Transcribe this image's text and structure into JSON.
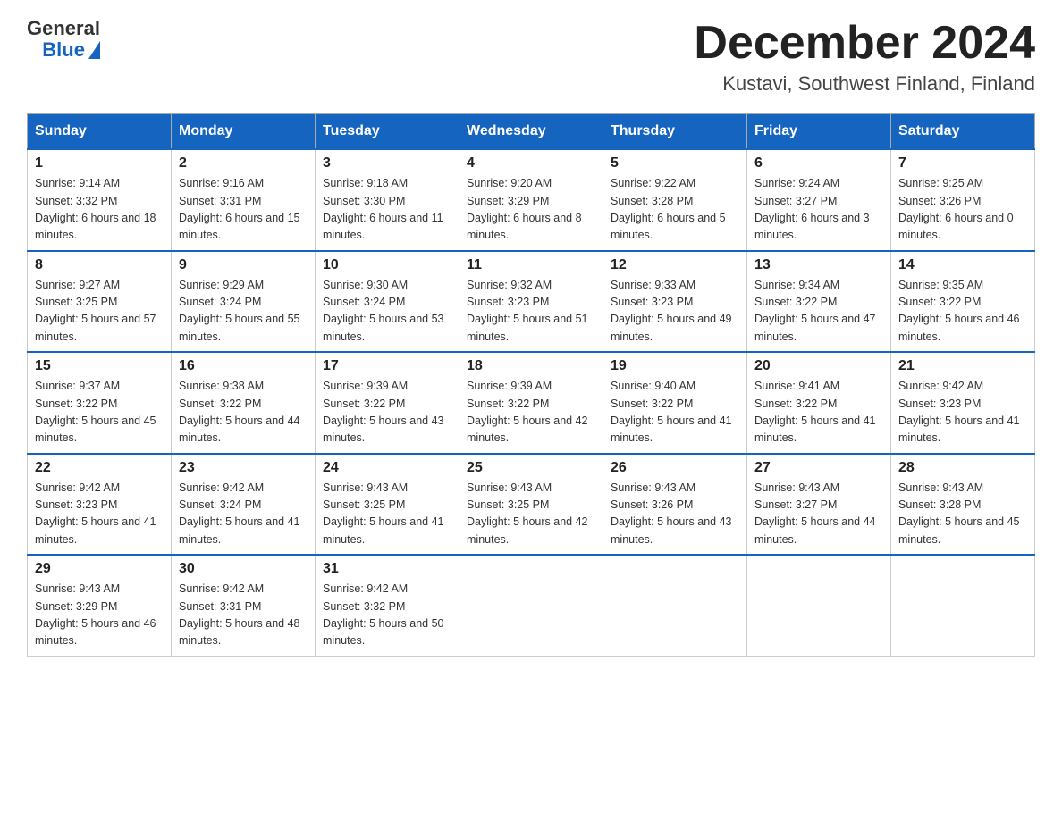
{
  "header": {
    "logo": {
      "text_general": "General",
      "text_blue": "Blue"
    },
    "title": "December 2024",
    "subtitle": "Kustavi, Southwest Finland, Finland"
  },
  "weekdays": [
    "Sunday",
    "Monday",
    "Tuesday",
    "Wednesday",
    "Thursday",
    "Friday",
    "Saturday"
  ],
  "weeks": [
    [
      {
        "day": 1,
        "sunrise": "9:14 AM",
        "sunset": "3:32 PM",
        "daylight": "6 hours and 18 minutes."
      },
      {
        "day": 2,
        "sunrise": "9:16 AM",
        "sunset": "3:31 PM",
        "daylight": "6 hours and 15 minutes."
      },
      {
        "day": 3,
        "sunrise": "9:18 AM",
        "sunset": "3:30 PM",
        "daylight": "6 hours and 11 minutes."
      },
      {
        "day": 4,
        "sunrise": "9:20 AM",
        "sunset": "3:29 PM",
        "daylight": "6 hours and 8 minutes."
      },
      {
        "day": 5,
        "sunrise": "9:22 AM",
        "sunset": "3:28 PM",
        "daylight": "6 hours and 5 minutes."
      },
      {
        "day": 6,
        "sunrise": "9:24 AM",
        "sunset": "3:27 PM",
        "daylight": "6 hours and 3 minutes."
      },
      {
        "day": 7,
        "sunrise": "9:25 AM",
        "sunset": "3:26 PM",
        "daylight": "6 hours and 0 minutes."
      }
    ],
    [
      {
        "day": 8,
        "sunrise": "9:27 AM",
        "sunset": "3:25 PM",
        "daylight": "5 hours and 57 minutes."
      },
      {
        "day": 9,
        "sunrise": "9:29 AM",
        "sunset": "3:24 PM",
        "daylight": "5 hours and 55 minutes."
      },
      {
        "day": 10,
        "sunrise": "9:30 AM",
        "sunset": "3:24 PM",
        "daylight": "5 hours and 53 minutes."
      },
      {
        "day": 11,
        "sunrise": "9:32 AM",
        "sunset": "3:23 PM",
        "daylight": "5 hours and 51 minutes."
      },
      {
        "day": 12,
        "sunrise": "9:33 AM",
        "sunset": "3:23 PM",
        "daylight": "5 hours and 49 minutes."
      },
      {
        "day": 13,
        "sunrise": "9:34 AM",
        "sunset": "3:22 PM",
        "daylight": "5 hours and 47 minutes."
      },
      {
        "day": 14,
        "sunrise": "9:35 AM",
        "sunset": "3:22 PM",
        "daylight": "5 hours and 46 minutes."
      }
    ],
    [
      {
        "day": 15,
        "sunrise": "9:37 AM",
        "sunset": "3:22 PM",
        "daylight": "5 hours and 45 minutes."
      },
      {
        "day": 16,
        "sunrise": "9:38 AM",
        "sunset": "3:22 PM",
        "daylight": "5 hours and 44 minutes."
      },
      {
        "day": 17,
        "sunrise": "9:39 AM",
        "sunset": "3:22 PM",
        "daylight": "5 hours and 43 minutes."
      },
      {
        "day": 18,
        "sunrise": "9:39 AM",
        "sunset": "3:22 PM",
        "daylight": "5 hours and 42 minutes."
      },
      {
        "day": 19,
        "sunrise": "9:40 AM",
        "sunset": "3:22 PM",
        "daylight": "5 hours and 41 minutes."
      },
      {
        "day": 20,
        "sunrise": "9:41 AM",
        "sunset": "3:22 PM",
        "daylight": "5 hours and 41 minutes."
      },
      {
        "day": 21,
        "sunrise": "9:42 AM",
        "sunset": "3:23 PM",
        "daylight": "5 hours and 41 minutes."
      }
    ],
    [
      {
        "day": 22,
        "sunrise": "9:42 AM",
        "sunset": "3:23 PM",
        "daylight": "5 hours and 41 minutes."
      },
      {
        "day": 23,
        "sunrise": "9:42 AM",
        "sunset": "3:24 PM",
        "daylight": "5 hours and 41 minutes."
      },
      {
        "day": 24,
        "sunrise": "9:43 AM",
        "sunset": "3:25 PM",
        "daylight": "5 hours and 41 minutes."
      },
      {
        "day": 25,
        "sunrise": "9:43 AM",
        "sunset": "3:25 PM",
        "daylight": "5 hours and 42 minutes."
      },
      {
        "day": 26,
        "sunrise": "9:43 AM",
        "sunset": "3:26 PM",
        "daylight": "5 hours and 43 minutes."
      },
      {
        "day": 27,
        "sunrise": "9:43 AM",
        "sunset": "3:27 PM",
        "daylight": "5 hours and 44 minutes."
      },
      {
        "day": 28,
        "sunrise": "9:43 AM",
        "sunset": "3:28 PM",
        "daylight": "5 hours and 45 minutes."
      }
    ],
    [
      {
        "day": 29,
        "sunrise": "9:43 AM",
        "sunset": "3:29 PM",
        "daylight": "5 hours and 46 minutes."
      },
      {
        "day": 30,
        "sunrise": "9:42 AM",
        "sunset": "3:31 PM",
        "daylight": "5 hours and 48 minutes."
      },
      {
        "day": 31,
        "sunrise": "9:42 AM",
        "sunset": "3:32 PM",
        "daylight": "5 hours and 50 minutes."
      },
      null,
      null,
      null,
      null
    ]
  ]
}
